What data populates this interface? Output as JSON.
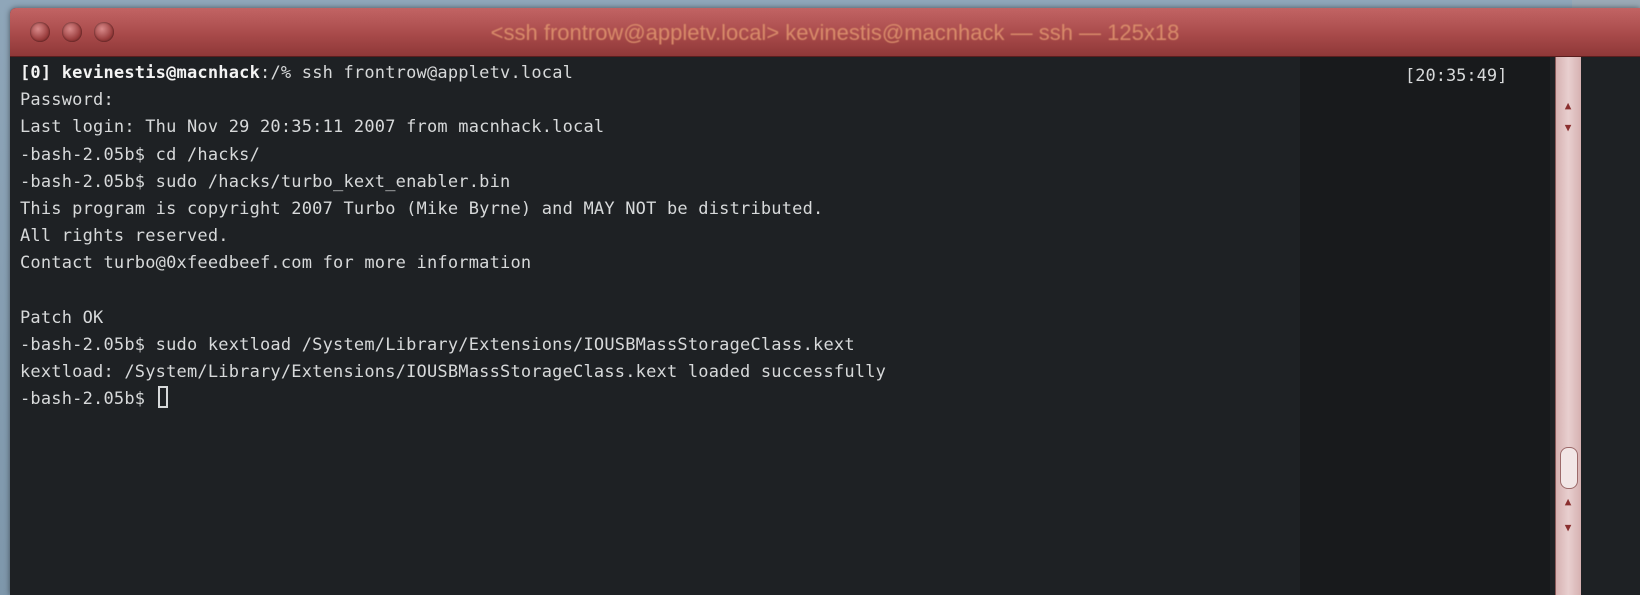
{
  "window": {
    "title": "<ssh frontrow@appletv.local> kevinestis@macnhack — ssh — 125x18",
    "timestamp": "[20:35:49]"
  },
  "terminal": {
    "prompt_user": "[0] kevinestis@macnhack",
    "lines": [
      ":/% ssh frontrow@appletv.local",
      "Password:",
      "Last login: Thu Nov 29 20:35:11 2007 from macnhack.local",
      "-bash-2.05b$ cd /hacks/",
      "-bash-2.05b$ sudo /hacks/turbo_kext_enabler.bin",
      "This program is copyright 2007 Turbo (Mike Byrne) and MAY NOT be distributed.",
      "All rights reserved.",
      "Contact turbo@0xfeedbeef.com for more information",
      "",
      "Patch OK",
      "-bash-2.05b$ sudo kextload /System/Library/Extensions/IOUSBMassStorageClass.kext",
      "kextload: /System/Library/Extensions/IOUSBMassStorageClass.kext loaded successfully",
      "-bash-2.05b$ "
    ]
  },
  "icons": {
    "close": "close-button-icon",
    "minimize": "minimize-button-icon",
    "zoom": "zoom-button-icon",
    "scroll_up": "scroll-up-arrow-icon",
    "scroll_down": "scroll-down-arrow-icon"
  },
  "colors": {
    "titlebar": "#a84a4a",
    "terminal_bg": "#1e2124",
    "terminal_text": "#d7d9da"
  }
}
